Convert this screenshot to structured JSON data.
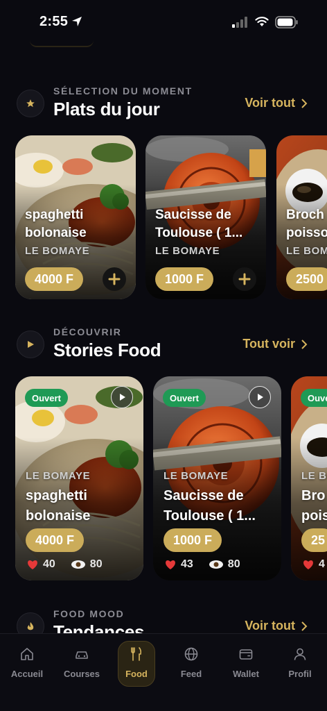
{
  "status": {
    "time": "2:55"
  },
  "plats": {
    "kicker": "SÉLECTION DU MOMENT",
    "title": "Plats du jour",
    "link": "Voir tout",
    "cards": [
      {
        "title1": "spaghetti",
        "title2": "bolonaise",
        "restaurant": "LE BOMAYE",
        "price": "4000 F"
      },
      {
        "title1": "Saucisse de",
        "title2": "Toulouse ( 1...",
        "restaurant": "LE BOMAYE",
        "price": "1000 F"
      },
      {
        "title1": "Broch",
        "title2": "poisso",
        "restaurant": "LE BOM",
        "price": "2500"
      }
    ]
  },
  "stories": {
    "kicker": "DÉCOUVRIR",
    "title": "Stories Food",
    "link": "Tout voir",
    "cards": [
      {
        "badge": "Ouvert",
        "restaurant": "LE BOMAYE",
        "title1": "spaghetti",
        "title2": "bolonaise",
        "price": "4000 F",
        "likes": "40",
        "views": "80"
      },
      {
        "badge": "Ouvert",
        "restaurant": "LE BOMAYE",
        "title1": "Saucisse de",
        "title2": "Toulouse ( 1...",
        "price": "1000 F",
        "likes": "43",
        "views": "80"
      },
      {
        "badge": "Ouve",
        "restaurant": "LE BO",
        "title1": "Bro",
        "title2": "pois",
        "price": "25",
        "likes": "4",
        "views": ""
      }
    ]
  },
  "mood": {
    "kicker": "FOOD MOOD",
    "title": "Tendances",
    "link": "Voir tout"
  },
  "tabs": [
    {
      "label": "Accueil",
      "icon": "home-icon"
    },
    {
      "label": "Courses",
      "icon": "car-icon"
    },
    {
      "label": "Food",
      "icon": "fork-knife-icon",
      "active": true
    },
    {
      "label": "Feed",
      "icon": "globe-icon"
    },
    {
      "label": "Wallet",
      "icon": "wallet-icon"
    },
    {
      "label": "Profil",
      "icon": "user-icon"
    }
  ],
  "colors": {
    "accent": "#d6b45e",
    "price_bg": "#cbac5a",
    "open_badge": "#1f9a55",
    "background": "#0a0a10"
  }
}
